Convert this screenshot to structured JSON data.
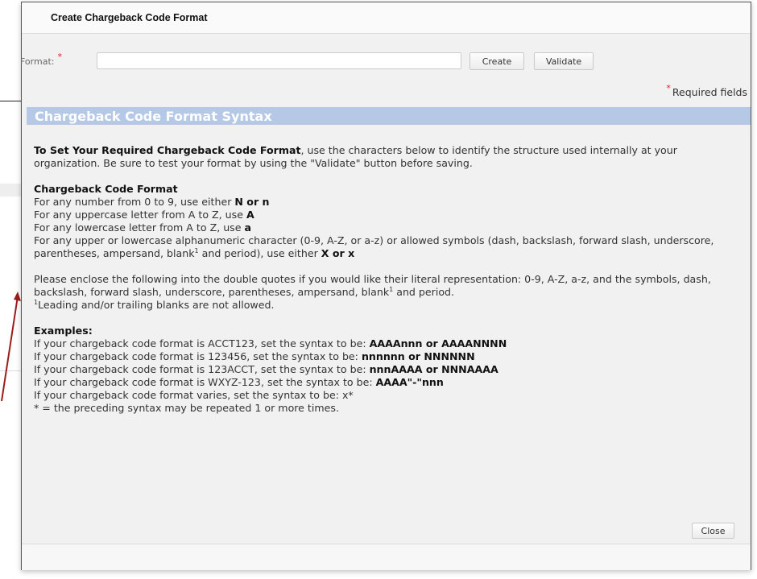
{
  "dialog": {
    "title": "Create Chargeback Code Format"
  },
  "format": {
    "label": "Format:",
    "required_star": "*",
    "value": "",
    "placeholder": ""
  },
  "buttons": {
    "create": "Create",
    "validate": "Validate",
    "close": "Close"
  },
  "required_note": {
    "star": "*",
    "text": "Required fields"
  },
  "syntax": {
    "header": "Chargeback Code Format Syntax",
    "intro_bold": "To Set Your Required Chargeback Code Format",
    "intro_rest": ", use the characters below to identify the structure used internally at your organization. Be sure to test your format by using the \"Validate\" button before saving.",
    "format_heading": "Chargeback Code Format",
    "rules": {
      "number_text": "For any number from 0 to 9, use either ",
      "number_code": "N or n",
      "upper_text": "For any uppercase letter from A to Z, use ",
      "upper_code": "A",
      "lower_text": "For any lowercase letter from A to Z, use ",
      "lower_code": "a",
      "alnum_text_1": "For any upper or lowercase alphanumeric character (0-9, A-Z, or a-z) or allowed symbols (dash, backslash, forward slash, underscore, parentheses, ampersand, blank",
      "alnum_sup": "1",
      "alnum_text_2": " and period), use either ",
      "alnum_code": "X or x"
    },
    "literal_text_1": "Please enclose the following into the double quotes if you would like their literal representation: 0-9, A-Z, a-z, and the symbols, dash, backslash, forward slash, underscore, parentheses, ampersand, blank",
    "literal_sup": "1",
    "literal_text_2": " and period.",
    "footnote_sup": "1",
    "footnote_text": "Leading and/or trailing blanks are not allowed.",
    "examples_heading": "Examples:",
    "examples": [
      {
        "text": "If your chargeback code format is ACCT123, set the syntax to be: ",
        "code": "AAAAnnn or AAAANNNN"
      },
      {
        "text": "If your chargeback code format is 123456, set the syntax to be: ",
        "code": "nnnnnn or NNNNNN"
      },
      {
        "text": "If your chargeback code format is 123ACCT, set the syntax to be: ",
        "code": "nnnAAAA or NNNAAAA"
      },
      {
        "text": "If your chargeback code format is WXYZ-123, set the syntax to be: ",
        "code": "AAAA\"-\"nnn"
      },
      {
        "text": "If your chargeback code format varies, set the syntax to be: x*",
        "code": ""
      }
    ],
    "repeat_note": "* = the preceding syntax may be repeated 1 or more times."
  },
  "colors": {
    "section_header_bg": "#b5c9e6",
    "required_star": "#e02020",
    "dialog_bg": "#f1f1f1",
    "arrow": "#9b1c1c"
  }
}
